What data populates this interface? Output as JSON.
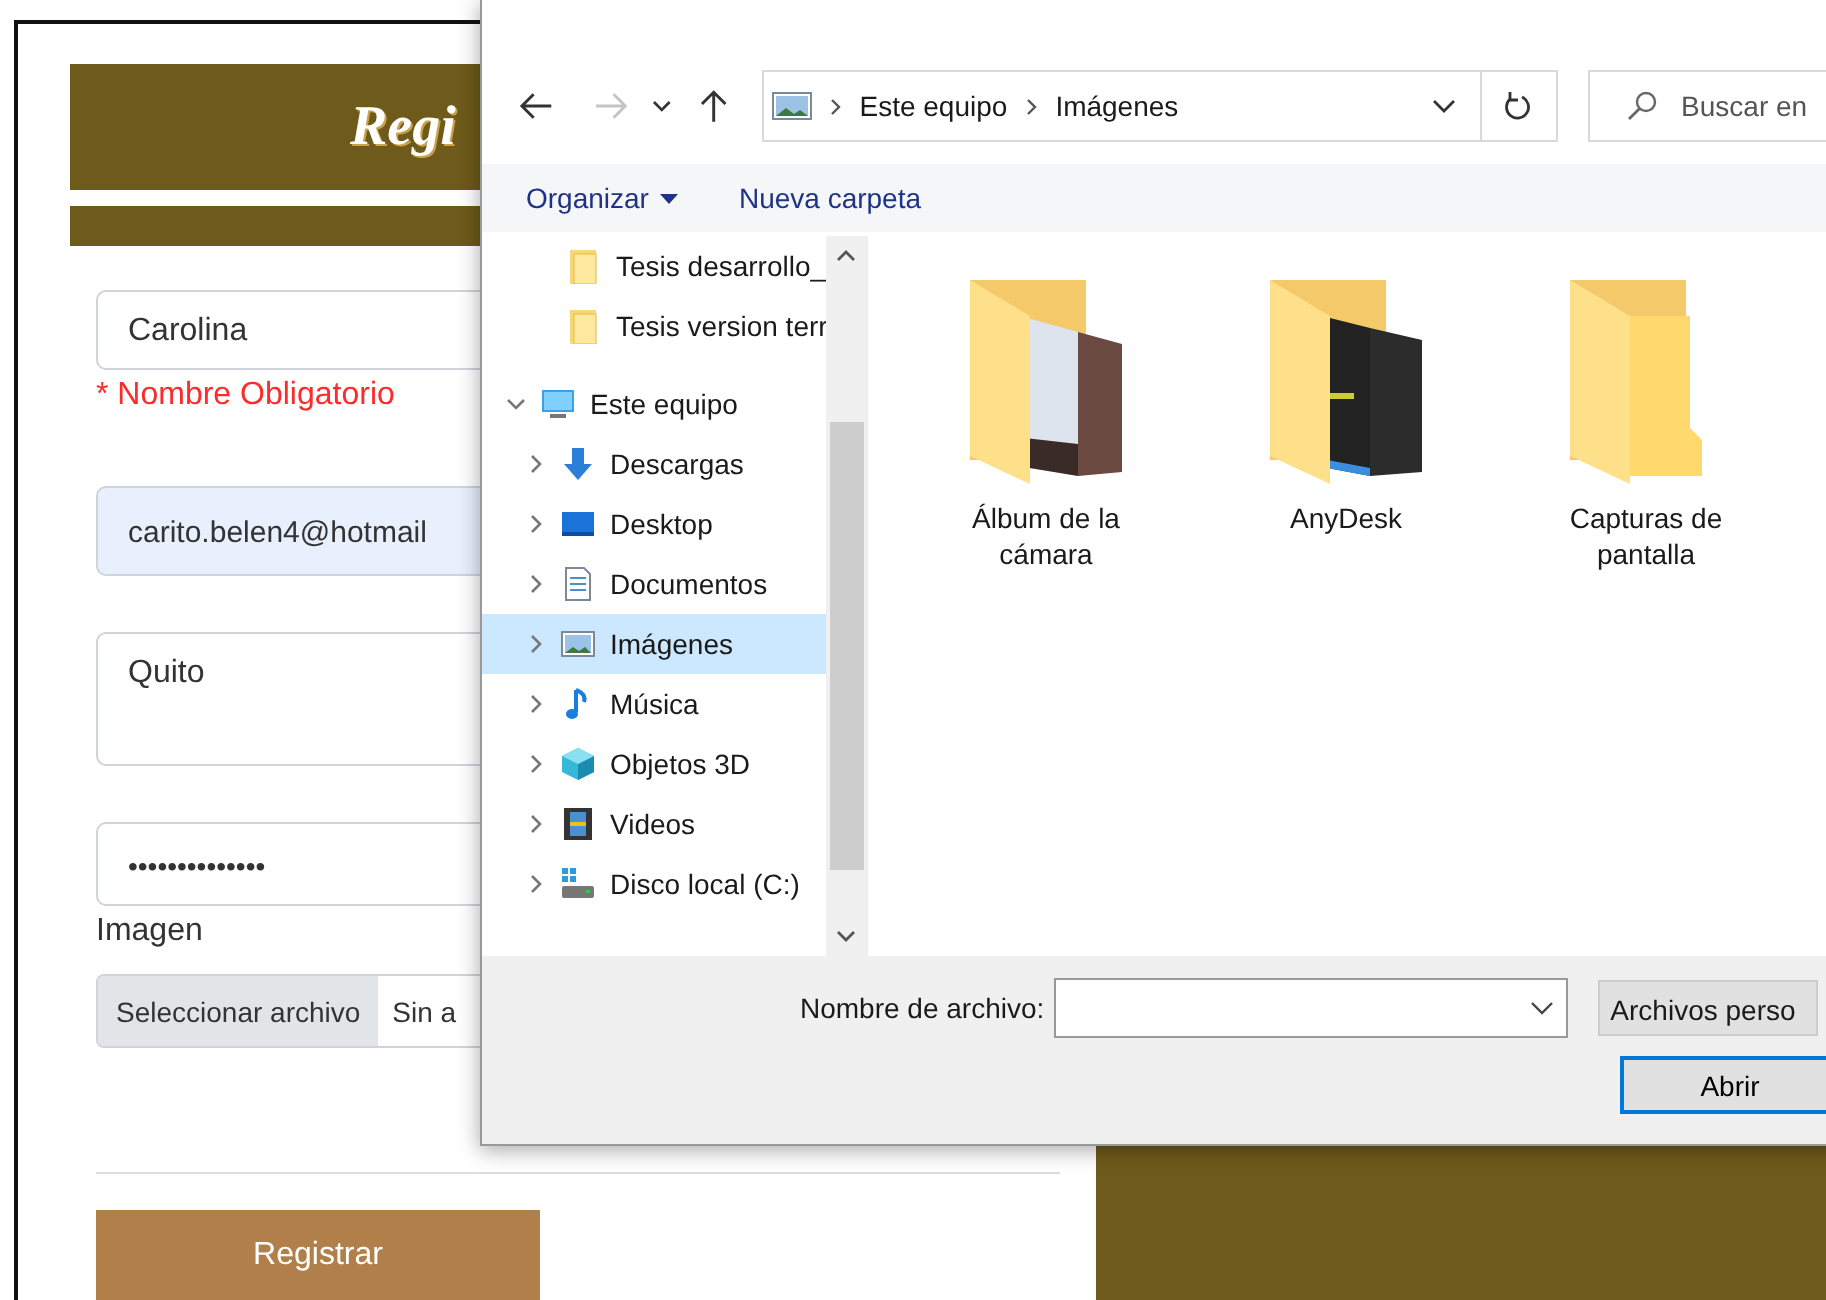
{
  "page": {
    "title": "Regi",
    "fields": [
      {
        "kind": "text",
        "value": "Carolina",
        "autofilled": false,
        "error": "* Nombre Obligatorio"
      },
      {
        "kind": "text",
        "value": "carito.belen4@hotmail",
        "autofilled": true
      },
      {
        "kind": "textarea",
        "value": "Quito",
        "autofilled": false
      },
      {
        "kind": "password",
        "value": "••••••••••••••",
        "autofilled": false
      }
    ],
    "image_label": "Imagen",
    "file_input": {
      "button": "Seleccionar archivo",
      "status": "Sin a"
    },
    "submit": "Registrar"
  },
  "dialog": {
    "nav": [
      {
        "kind": "back",
        "disabled": false
      },
      {
        "kind": "forward",
        "disabled": true
      },
      {
        "kind": "recent",
        "disabled": false
      },
      {
        "kind": "up",
        "disabled": false
      }
    ],
    "address": [
      "Este equipo",
      "Imágenes"
    ],
    "search": {
      "placeholder": "Buscar en"
    },
    "toolbar": [
      {
        "label": "Organizar",
        "dropdown": true
      },
      {
        "label": "Nueva carpeta",
        "dropdown": false
      }
    ],
    "tree": [
      {
        "label": "Tesis desarrollo_",
        "kind": "folder",
        "selected": false
      },
      {
        "label": "Tesis version terr",
        "kind": "folder",
        "selected": false
      },
      {
        "label": "Este equipo",
        "kind": "computer",
        "selected": false,
        "expanded": true,
        "children": [
          {
            "label": "Descargas",
            "kind": "download",
            "selected": false,
            "expanded": false
          },
          {
            "label": "Desktop",
            "kind": "desktop",
            "selected": false,
            "expanded": false
          },
          {
            "label": "Documentos",
            "kind": "documents",
            "selected": false,
            "expanded": false
          },
          {
            "label": "Imágenes",
            "kind": "pictures",
            "selected": true,
            "expanded": false
          },
          {
            "label": "Música",
            "kind": "music",
            "selected": false,
            "expanded": false
          },
          {
            "label": "Objetos 3D",
            "kind": "objects3d",
            "selected": false,
            "expanded": false
          },
          {
            "label": "Videos",
            "kind": "videos",
            "selected": false,
            "expanded": false
          },
          {
            "label": "Disco local (C:)",
            "kind": "drive",
            "selected": false,
            "expanded": false
          }
        ]
      }
    ],
    "files": [
      {
        "name": "Álbum de la cámara",
        "kind": "photos"
      },
      {
        "name": "AnyDesk",
        "kind": "dark"
      },
      {
        "name": "Capturas de pantalla",
        "kind": "empty"
      }
    ],
    "filename_label": "Nombre de archivo:",
    "filter": "Archivos perso",
    "open_button": "Abrir"
  }
}
